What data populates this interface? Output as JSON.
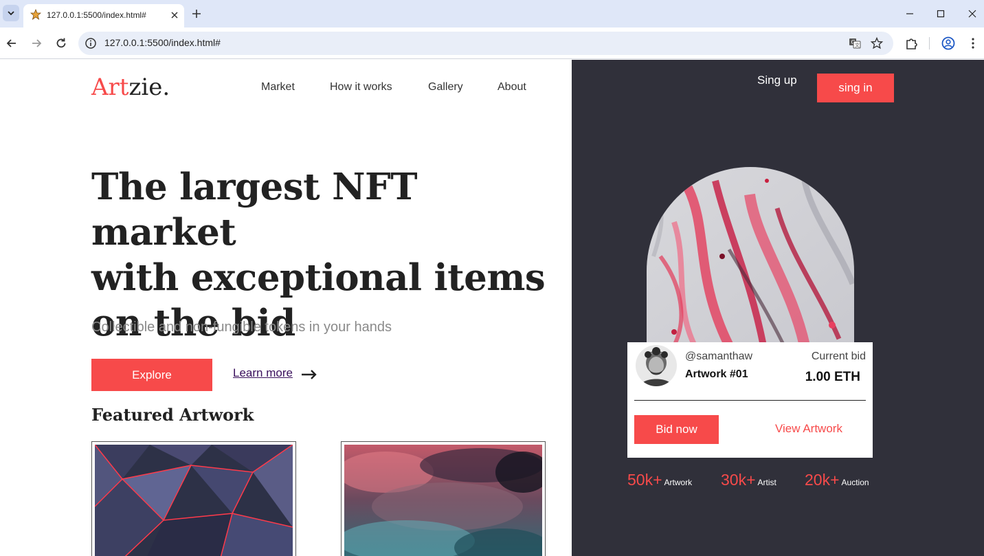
{
  "browser": {
    "tab_title": "127.0.0.1:5500/index.html#",
    "url": "127.0.0.1:5500/index.html#"
  },
  "logo": {
    "accent": "Art",
    "rest": "zie."
  },
  "nav": {
    "items": [
      {
        "label": "Market"
      },
      {
        "label": "How it works"
      },
      {
        "label": "Gallery"
      },
      {
        "label": "About"
      }
    ],
    "signup": "Sing up",
    "signin": "sing in"
  },
  "hero": {
    "title_lines": [
      "The largest NFT market",
      "with exceptional items",
      "on the bid"
    ],
    "subtitle": "Collectible and non-fungible tokens in your hands",
    "explore": "Explore",
    "learn_more": "Learn more"
  },
  "featured": {
    "title": "Featured Artwork"
  },
  "bid_card": {
    "username": "@samanthaw",
    "artwork": "Artwork #01",
    "bid_label": "Current bid",
    "bid_value": "1.00 ETH",
    "bid_button": "Bid now",
    "view_link": "View Artwork"
  },
  "stats": [
    {
      "value": "50k+",
      "label": "Artwork"
    },
    {
      "value": "30k+",
      "label": "Artist"
    },
    {
      "value": "20k+",
      "label": "Auction"
    }
  ],
  "colors": {
    "accent": "#f74a4a",
    "dark_panel": "#30303a",
    "link": "#3a0f5c"
  },
  "icons": [
    "chevron-down-icon",
    "star-favicon-icon",
    "close-icon",
    "plus-icon",
    "minimize-icon",
    "maximize-icon",
    "back-icon",
    "forward-icon",
    "reload-icon",
    "site-info-icon",
    "translate-icon",
    "bookmark-star-icon",
    "extensions-icon",
    "profile-icon",
    "kebab-menu-icon",
    "arrow-right-icon"
  ]
}
